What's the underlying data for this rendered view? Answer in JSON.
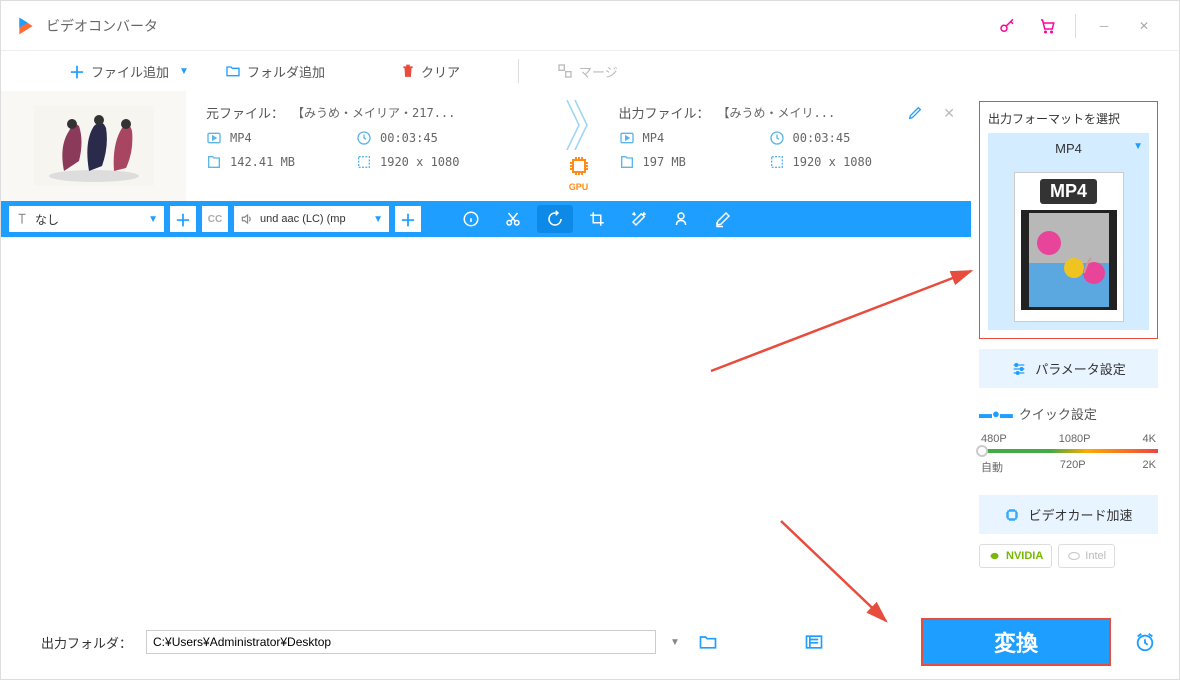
{
  "app": {
    "title": "ビデオコンバータ"
  },
  "toolbar": {
    "addFile": "ファイル追加",
    "addFolder": "フォルダ追加",
    "clear": "クリア",
    "merge": "マージ"
  },
  "file": {
    "source": {
      "label": "元ファイル：",
      "name": "【みうめ・メイリア・217...",
      "format": "MP4",
      "duration": "00:03:45",
      "size": "142.41 MB",
      "resolution": "1920 x 1080"
    },
    "output": {
      "label": "出力ファイル：",
      "name": "【みうめ・メイリ...",
      "format": "MP4",
      "duration": "00:03:45",
      "size": "197 MB",
      "resolution": "1920 x 1080"
    },
    "gpu": "GPU"
  },
  "editBar": {
    "subtitle": "なし",
    "audio": "und aac (LC) (mp"
  },
  "sidebar": {
    "formatTitle": "出力フォーマットを選択",
    "formatValue": "MP4",
    "formatBadge": "MP4",
    "paramBtn": "パラメータ設定",
    "quickTitle": "クイック設定",
    "resTop": [
      "480P",
      "1080P",
      "4K"
    ],
    "resBottom": [
      "自動",
      "720P",
      "2K"
    ],
    "gpuAccel": "ビデオカード加速",
    "nvidia": "NVIDIA",
    "intel": "Intel"
  },
  "bottom": {
    "outLabel": "出力フォルダ：",
    "outPath": "C:¥Users¥Administrator¥Desktop",
    "convert": "変換"
  }
}
